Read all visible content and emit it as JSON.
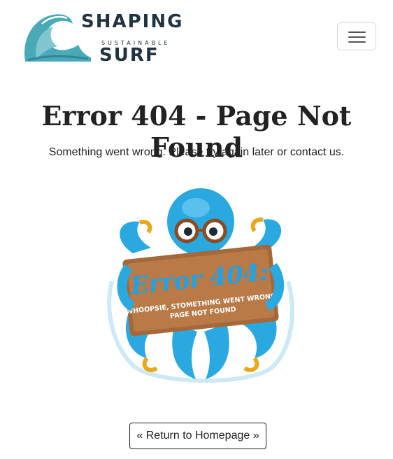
{
  "header": {
    "logo": {
      "line1": "SHAPING",
      "line2": "SUSTAINABLE",
      "line3": "SURF"
    },
    "menu_icon": "hamburger-icon"
  },
  "main": {
    "title": "Error 404 - Page Not Found",
    "message": "Something went wrong. Please try again later or contact us.",
    "illustration": {
      "sign_title": "Error 404:",
      "sign_line1": "WHOOPSIE, STOMETHING WENT WRONG,",
      "sign_line2": "PAGE NOT FOUND"
    },
    "return_button": "« Return to Homepage »"
  },
  "colors": {
    "brand_dark": "#1f3340",
    "wave": "#4aa9b8",
    "octopus": "#2aa8e0",
    "tentacle_accent": "#e8a81a",
    "wood": "#a4683a"
  }
}
